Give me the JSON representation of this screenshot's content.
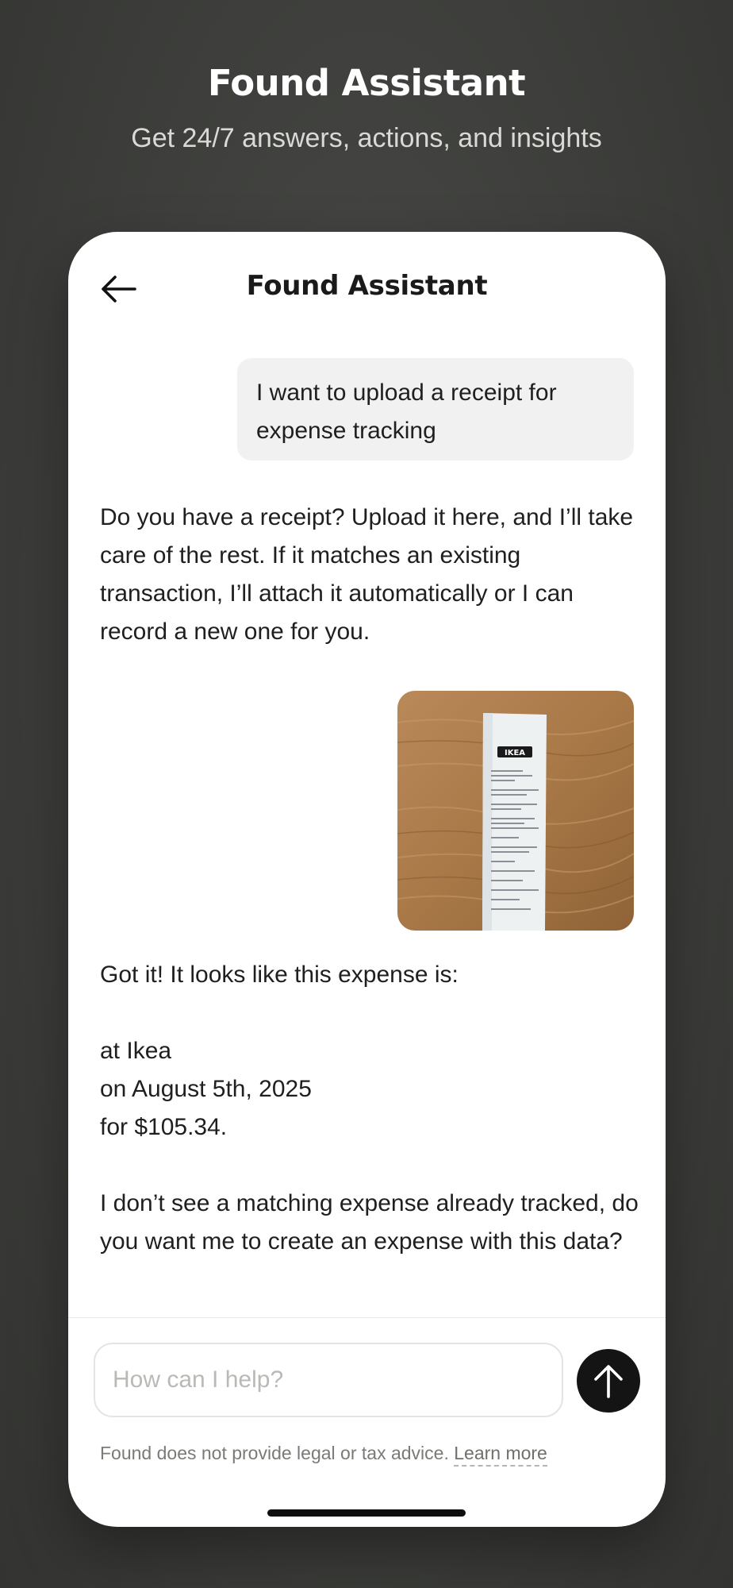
{
  "hero": {
    "title": "Found Assistant",
    "subtitle": "Get 24/7 answers, actions, and insights"
  },
  "header": {
    "back_icon": "arrow-left-icon",
    "title": "Found Assistant"
  },
  "messages": {
    "user_1": "I want to upload a receipt for expense tracking",
    "assistant_1": "Do you have a receipt? Upload it here, and I’ll take care of the rest. If it matches an existing transaction, I’ll attach it automatically or I can record a new one for you.",
    "receipt_logo": "IKEA",
    "assistant_2": {
      "intro": "Got it! It looks like this expense is:",
      "merchant": "at Ikea",
      "date": "on August 5th, 2025",
      "amount": "for $105.34.",
      "question": "I don’t see a matching expense already tracked, do you want me to create an expense with this data?"
    }
  },
  "composer": {
    "placeholder": "How can I help?",
    "send_icon": "arrow-up-icon"
  },
  "footer": {
    "disclaimer": "Found does not provide legal or tax advice.",
    "learn_more": "Learn more"
  },
  "colors": {
    "background": "#3d3e3b",
    "card": "#ffffff",
    "user_bubble": "#f0f1f0",
    "send_button": "#141414"
  }
}
